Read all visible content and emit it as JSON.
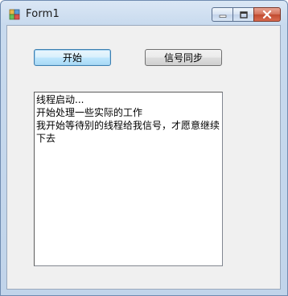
{
  "window": {
    "title": "Form1",
    "icons": {
      "app": "winforms-app-icon",
      "minimize": "minimize-icon",
      "maximize": "maximize-icon",
      "close": "close-icon"
    }
  },
  "form": {
    "start_button": "开始",
    "sync_button": "信号同步",
    "log_lines": [
      "线程启动...",
      "开始处理一些实际的工作",
      "我开始等待别的线程给我信号，才愿意继续下去"
    ]
  },
  "colors": {
    "client_bg": "#f0f0f0",
    "close_button": "#c14b30",
    "focused_button_border": "#3c7fb1"
  }
}
